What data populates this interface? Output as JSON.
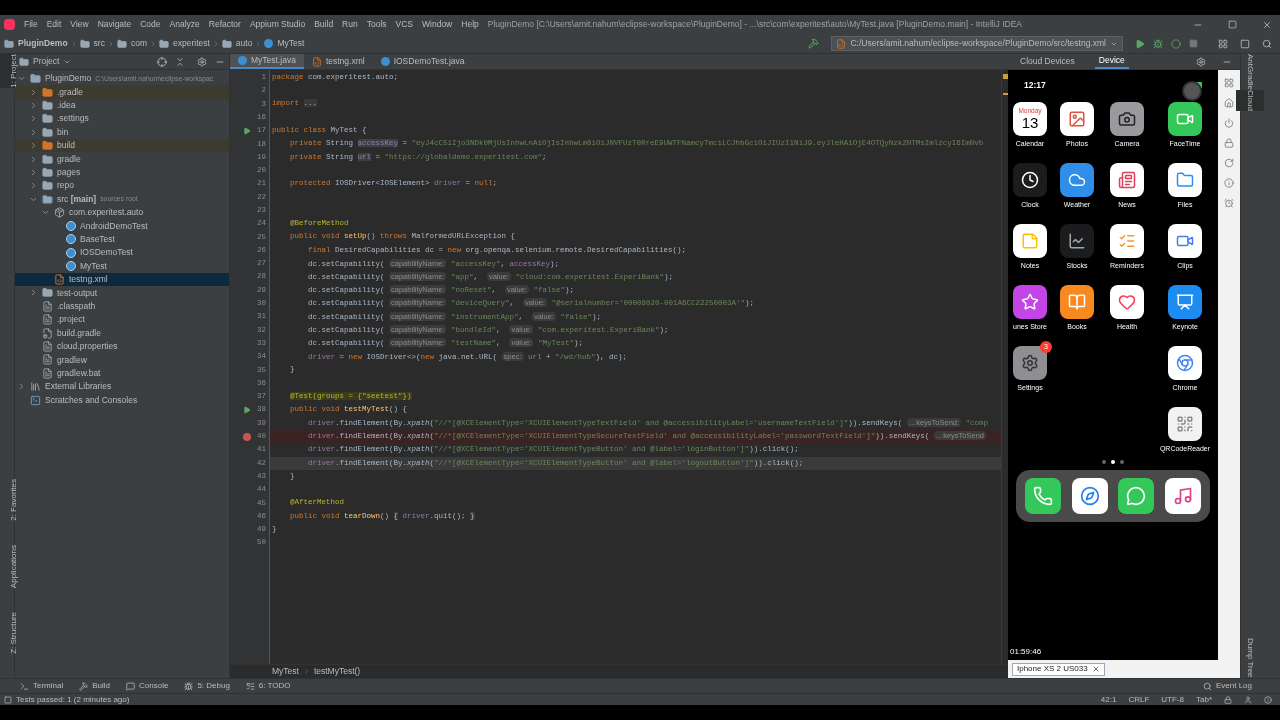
{
  "menu_bar": {
    "items": [
      "File",
      "Edit",
      "View",
      "Navigate",
      "Code",
      "Analyze",
      "Refactor",
      "Appium Studio",
      "Build",
      "Run",
      "Tools",
      "VCS",
      "Window",
      "Help"
    ],
    "title": "PluginDemo [C:\\Users\\amit.nahum\\eclipse-workspace\\PluginDemo] - ...\\src\\com\\experitest\\auto\\MyTest.java [PluginDemo.main] - IntelliJ IDEA"
  },
  "nav_bar": {
    "breadcrumbs": [
      {
        "label": "PluginDemo",
        "kind": "module"
      },
      {
        "label": "src",
        "kind": "folder"
      },
      {
        "label": "com",
        "kind": "folder"
      },
      {
        "label": "experitest",
        "kind": "folder"
      },
      {
        "label": "auto",
        "kind": "folder"
      },
      {
        "label": "MyTest",
        "kind": "class"
      }
    ],
    "run_config": "C:/Users/amit.nahum/eclipse-workspace/PluginDemo/src/testng.xml"
  },
  "left_stripe": [
    {
      "label": "1: Project",
      "selected": true
    },
    {
      "label": "2: Favorites",
      "selected": false
    },
    {
      "label": "Applications",
      "selected": false
    },
    {
      "label": "Z: Structure",
      "selected": false
    }
  ],
  "project_panel": {
    "title": "Project",
    "tree": [
      {
        "label": "PluginDemo",
        "hint": "C:\\Users\\amit.nahum\\eclipse-workspac",
        "kind": "module",
        "expanded": true,
        "selected": false,
        "children": [
          {
            "label": ".gradle",
            "kind": "excluded",
            "expanded": false,
            "selected": false
          },
          {
            "label": ".idea",
            "kind": "folder",
            "expanded": false,
            "selected": false
          },
          {
            "label": ".settings",
            "kind": "folder",
            "expanded": false,
            "selected": false
          },
          {
            "label": "bin",
            "kind": "folder",
            "expanded": false,
            "selected": false
          },
          {
            "label": "build",
            "kind": "excluded",
            "expanded": false,
            "selected": false
          },
          {
            "label": "gradle",
            "kind": "folder",
            "expanded": false,
            "selected": false
          },
          {
            "label": "pages",
            "kind": "folder",
            "expanded": false,
            "selected": false
          },
          {
            "label": "repo",
            "kind": "folder",
            "expanded": false,
            "selected": false
          },
          {
            "label": "src **[main]**",
            "hint": "sources root",
            "kind": "source",
            "expanded": true,
            "selected": false,
            "children": [
              {
                "label": "com.experitest.auto",
                "kind": "package",
                "expanded": true,
                "selected": false,
                "children": [
                  {
                    "label": "AndroidDemoTest",
                    "kind": "class",
                    "selected": false
                  },
                  {
                    "label": "BaseTest",
                    "kind": "class",
                    "selected": false
                  },
                  {
                    "label": "IOSDemoTest",
                    "kind": "class",
                    "selected": false
                  },
                  {
                    "label": "MyTest",
                    "kind": "class",
                    "selected": false
                  }
                ]
              },
              {
                "label": "testng.xml",
                "kind": "xml",
                "selected": true
              }
            ]
          },
          {
            "label": "test-output",
            "kind": "folder",
            "expanded": false,
            "selected": false
          },
          {
            "label": ".classpath",
            "kind": "file",
            "selected": false
          },
          {
            "label": ".project",
            "kind": "file",
            "selected": false
          },
          {
            "label": "build.gradle",
            "kind": "gradle",
            "selected": false
          },
          {
            "label": "cloud.properties",
            "kind": "file",
            "selected": false
          },
          {
            "label": "gradlew",
            "kind": "file",
            "selected": false
          },
          {
            "label": "gradlew.bat",
            "kind": "file",
            "selected": false
          }
        ]
      },
      {
        "label": "External Libraries",
        "kind": "libraries",
        "expanded": false,
        "selected": false
      },
      {
        "label": "Scratches and Consoles",
        "kind": "scratches",
        "selected": false
      }
    ]
  },
  "editor": {
    "tabs": [
      {
        "label": "MyTest.java",
        "kind": "class",
        "selected": true
      },
      {
        "label": "testng.xml",
        "kind": "xml",
        "selected": false
      },
      {
        "label": "IOSDemoTest.java",
        "kind": "class",
        "selected": false
      }
    ],
    "lines": [
      {
        "num": "1",
        "runnable": false,
        "breakpoint": false,
        "current": false,
        "tokens": [
          {
            "kind": "kw",
            "text": "package"
          },
          {
            "kind": "plain",
            "text": " com.experitest.auto;"
          }
        ]
      },
      {
        "num": "2",
        "runnable": false,
        "breakpoint": false,
        "current": false
      },
      {
        "num": "3",
        "runnable": false,
        "breakpoint": false,
        "current": false,
        "tokens": [
          {
            "kind": "kw",
            "text": "import "
          },
          {
            "kind": "fold",
            "text": "..."
          }
        ]
      },
      {
        "num": "16",
        "runnable": false,
        "breakpoint": false,
        "current": false
      },
      {
        "num": "17",
        "runnable": true,
        "breakpoint": false,
        "current": false,
        "tokens": [
          {
            "kind": "kw",
            "text": "public class"
          },
          {
            "kind": "plain",
            "text": " MyTest {"
          }
        ]
      },
      {
        "num": "18",
        "runnable": false,
        "breakpoint": false,
        "current": false,
        "tokens": [
          {
            "kind": "kw",
            "text": "    private"
          },
          {
            "kind": "plain",
            "text": " String "
          },
          {
            "kind": "field_hl",
            "text": "accessKey"
          },
          {
            "kind": "plain",
            "text": " = "
          },
          {
            "kind": "str",
            "text": "\"eyJ4cC51Ijo3NDk0MjUsInhwLnAiOjIsInhwLm0iOiJNVFUzT0RreE9UWTFNamcyTmciLCJhbGciOiJIUzI1NiJ9.eyJleHAiOjE4OTQyNzk2NTMsImlzcyI6ImNvb"
          }
        ]
      },
      {
        "num": "19",
        "runnable": false,
        "breakpoint": false,
        "current": false,
        "tokens": [
          {
            "kind": "kw",
            "text": "    private"
          },
          {
            "kind": "plain",
            "text": " String "
          },
          {
            "kind": "field_hl",
            "text": "url"
          },
          {
            "kind": "plain",
            "text": " = "
          },
          {
            "kind": "str",
            "text": "\"https://globaldemo.experitest.com\""
          },
          {
            "kind": "plain",
            "text": ";"
          }
        ]
      },
      {
        "num": "20",
        "runnable": false,
        "breakpoint": false,
        "current": false
      },
      {
        "num": "21",
        "runnable": false,
        "breakpoint": false,
        "current": false,
        "tokens": [
          {
            "kind": "kw",
            "text": "    protected"
          },
          {
            "kind": "plain",
            "text": " IOSDriver<IOSElement> "
          },
          {
            "kind": "field",
            "text": "driver"
          },
          {
            "kind": "plain",
            "text": " = "
          },
          {
            "kind": "kw",
            "text": "null"
          },
          {
            "kind": "plain",
            "text": ";"
          }
        ]
      },
      {
        "num": "22",
        "runnable": false,
        "breakpoint": false,
        "current": false
      },
      {
        "num": "23",
        "runnable": false,
        "breakpoint": false,
        "current": false
      },
      {
        "num": "24",
        "runnable": false,
        "breakpoint": false,
        "current": false,
        "tokens": [
          {
            "kind": "ann",
            "text": "    @BeforeMethod"
          }
        ]
      },
      {
        "num": "25",
        "runnable": false,
        "breakpoint": false,
        "current": false,
        "tokens": [
          {
            "kind": "kw",
            "text": "    public void "
          },
          {
            "kind": "method",
            "text": "setUp"
          },
          {
            "kind": "plain",
            "text": "() "
          },
          {
            "kind": "kw",
            "text": "throws"
          },
          {
            "kind": "plain",
            "text": " MalformedURLException {"
          }
        ]
      },
      {
        "num": "26",
        "runnable": false,
        "breakpoint": false,
        "current": false,
        "tokens": [
          {
            "kind": "kw",
            "text": "        final"
          },
          {
            "kind": "plain",
            "text": " DesiredCapabilities dc = "
          },
          {
            "kind": "kw",
            "text": "new"
          },
          {
            "kind": "plain",
            "text": " org.openqa.selenium.remote.DesiredCapabilities();"
          }
        ]
      },
      {
        "num": "27",
        "runnable": false,
        "breakpoint": false,
        "current": false,
        "tokens": [
          {
            "kind": "plain",
            "text": "        dc.setCapability( "
          },
          {
            "kind": "hint",
            "text": "capabilityName:"
          },
          {
            "kind": "str",
            "text": " \"accessKey\""
          },
          {
            "kind": "plain",
            "text": ", "
          },
          {
            "kind": "field",
            "text": "accessKey"
          },
          {
            "kind": "plain",
            "text": ");"
          }
        ]
      },
      {
        "num": "28",
        "runnable": false,
        "breakpoint": false,
        "current": false,
        "tokens": [
          {
            "kind": "plain",
            "text": "        dc.setCapability( "
          },
          {
            "kind": "hint",
            "text": "capabilityName:"
          },
          {
            "kind": "str",
            "text": " \"app\""
          },
          {
            "kind": "plain",
            "text": ",  "
          },
          {
            "kind": "hint",
            "text": "value:"
          },
          {
            "kind": "str",
            "text": " \"cloud:com.experitest.ExperiBank\""
          },
          {
            "kind": "plain",
            "text": ");"
          }
        ]
      },
      {
        "num": "29",
        "runnable": false,
        "breakpoint": false,
        "current": false,
        "tokens": [
          {
            "kind": "plain",
            "text": "        dc.setCapability( "
          },
          {
            "kind": "hint",
            "text": "capabilityName:"
          },
          {
            "kind": "str",
            "text": " \"noReset\""
          },
          {
            "kind": "plain",
            "text": ",  "
          },
          {
            "kind": "hint",
            "text": "value:"
          },
          {
            "kind": "str",
            "text": " \"false\""
          },
          {
            "kind": "plain",
            "text": ");"
          }
        ]
      },
      {
        "num": "30",
        "runnable": false,
        "breakpoint": false,
        "current": false,
        "tokens": [
          {
            "kind": "plain",
            "text": "        dc.setCapability( "
          },
          {
            "kind": "hint",
            "text": "capabilityName:"
          },
          {
            "kind": "str",
            "text": " \"deviceQuery\""
          },
          {
            "kind": "plain",
            "text": ",  "
          },
          {
            "kind": "hint",
            "text": "value:"
          },
          {
            "kind": "str",
            "text": " \"@serialnumber='00008020-001A6CC22250003A'\""
          },
          {
            "kind": "plain",
            "text": ");"
          }
        ]
      },
      {
        "num": "31",
        "runnable": false,
        "breakpoint": false,
        "current": false,
        "tokens": [
          {
            "kind": "plain",
            "text": "        dc.setCapability( "
          },
          {
            "kind": "hint",
            "text": "capabilityName:"
          },
          {
            "kind": "str",
            "text": " \"instrumentApp\""
          },
          {
            "kind": "plain",
            "text": ",  "
          },
          {
            "kind": "hint",
            "text": "value:"
          },
          {
            "kind": "str",
            "text": " \"false\""
          },
          {
            "kind": "plain",
            "text": ");"
          }
        ]
      },
      {
        "num": "32",
        "runnable": false,
        "breakpoint": false,
        "current": false,
        "tokens": [
          {
            "kind": "plain",
            "text": "        dc.setCapability( "
          },
          {
            "kind": "hint",
            "text": "capabilityName:"
          },
          {
            "kind": "str",
            "text": " \"bundleId\""
          },
          {
            "kind": "plain",
            "text": ",  "
          },
          {
            "kind": "hint",
            "text": "value:"
          },
          {
            "kind": "str",
            "text": " \"com.experitest.ExperiBank\""
          },
          {
            "kind": "plain",
            "text": ");"
          }
        ]
      },
      {
        "num": "33",
        "runnable": false,
        "breakpoint": false,
        "current": false,
        "tokens": [
          {
            "kind": "plain",
            "text": "        dc.setCapability( "
          },
          {
            "kind": "hint",
            "text": "capabilityName:"
          },
          {
            "kind": "str",
            "text": " \"testName\""
          },
          {
            "kind": "plain",
            "text": ",  "
          },
          {
            "kind": "hint",
            "text": "value:"
          },
          {
            "kind": "str",
            "text": " \"MyTest\""
          },
          {
            "kind": "plain",
            "text": ");"
          }
        ]
      },
      {
        "num": "34",
        "runnable": false,
        "breakpoint": false,
        "current": false,
        "tokens": [
          {
            "kind": "field",
            "text": "        driver"
          },
          {
            "kind": "plain",
            "text": " = "
          },
          {
            "kind": "kw",
            "text": "new"
          },
          {
            "kind": "plain",
            "text": " IOSDriver<>("
          },
          {
            "kind": "kw",
            "text": "new"
          },
          {
            "kind": "plain",
            "text": " java.net.URL( "
          },
          {
            "kind": "hint",
            "text": "spec:"
          },
          {
            "kind": "field",
            "text": " url"
          },
          {
            "kind": "plain",
            "text": " + "
          },
          {
            "kind": "str",
            "text": "\"/wd/hub\""
          },
          {
            "kind": "plain",
            "text": "), dc);"
          }
        ]
      },
      {
        "num": "35",
        "runnable": false,
        "breakpoint": false,
        "current": false,
        "tokens": [
          {
            "kind": "plain",
            "text": "    }"
          }
        ]
      },
      {
        "num": "36",
        "runnable": false,
        "breakpoint": false,
        "current": false
      },
      {
        "num": "37",
        "runnable": false,
        "breakpoint": false,
        "current": false,
        "tokens": [
          {
            "kind": "ann_hl",
            "text": "    @Test(groups = {\"seetest\"})"
          }
        ]
      },
      {
        "num": "38",
        "runnable": true,
        "breakpoint": false,
        "current": false,
        "tokens": [
          {
            "kind": "kw",
            "text": "    public void "
          },
          {
            "kind": "method",
            "text": "testMyTest"
          },
          {
            "kind": "plain",
            "text": "() {"
          }
        ]
      },
      {
        "num": "39",
        "runnable": false,
        "breakpoint": false,
        "current": false,
        "tokens": [
          {
            "kind": "field",
            "text": "        driver"
          },
          {
            "kind": "plain",
            "text": ".findElement(By."
          },
          {
            "kind": "italic",
            "text": "xpath"
          },
          {
            "kind": "plain",
            "text": "("
          },
          {
            "kind": "str",
            "text": "\"//*[@XCElementType='XCUIElementTypeTextField' and @accessibilityLabel='usernameTextField']\""
          },
          {
            "kind": "plain",
            "text": ")).sendKeys( "
          },
          {
            "kind": "hint",
            "text": "…keysToSend:"
          },
          {
            "kind": "str",
            "text": " \"comp"
          }
        ]
      },
      {
        "num": "40",
        "runnable": false,
        "breakpoint": true,
        "current": false,
        "tokens": [
          {
            "kind": "field",
            "text": "        driver"
          },
          {
            "kind": "plain",
            "text": ".findElement(By."
          },
          {
            "kind": "italic",
            "text": "xpath"
          },
          {
            "kind": "plain",
            "text": "("
          },
          {
            "kind": "str",
            "text": "\"//*[@XCElementType='XCUIElementTypeSecureTextField' and @accessibilityLabel='passwordTextField']\""
          },
          {
            "kind": "plain",
            "text": ")).sendKeys( "
          },
          {
            "kind": "hint",
            "text": "…keysToSend"
          }
        ]
      },
      {
        "num": "41",
        "runnable": false,
        "breakpoint": false,
        "current": false,
        "tokens": [
          {
            "kind": "field",
            "text": "        driver"
          },
          {
            "kind": "plain",
            "text": ".findElement(By."
          },
          {
            "kind": "italic",
            "text": "xpath"
          },
          {
            "kind": "plain",
            "text": "("
          },
          {
            "kind": "str",
            "text": "\"//*[@XCElementType='XCUIElementTypeButton' and @label='loginButton']\""
          },
          {
            "kind": "plain",
            "text": ")).click();"
          }
        ]
      },
      {
        "num": "42",
        "runnable": false,
        "breakpoint": false,
        "current": true,
        "tokens": [
          {
            "kind": "field",
            "text": "        driver"
          },
          {
            "kind": "plain",
            "text": ".findElement(By."
          },
          {
            "kind": "italic",
            "text": "xpath"
          },
          {
            "kind": "plain",
            "text": "("
          },
          {
            "kind": "str",
            "text": "\"//*[@XCElementType='XCUIElementTypeButton' and @label='logoutButton']\""
          },
          {
            "kind": "plain",
            "text": ")).click();"
          }
        ]
      },
      {
        "num": "43",
        "runnable": false,
        "breakpoint": false,
        "current": false,
        "tokens": [
          {
            "kind": "plain",
            "text": "    }"
          }
        ]
      },
      {
        "num": "44",
        "runnable": false,
        "breakpoint": false,
        "current": false
      },
      {
        "num": "45",
        "runnable": false,
        "breakpoint": false,
        "current": false,
        "tokens": [
          {
            "kind": "ann",
            "text": "    @AfterMethod"
          }
        ]
      },
      {
        "num": "46",
        "runnable": false,
        "breakpoint": false,
        "current": false,
        "tokens": [
          {
            "kind": "kw",
            "text": "    public void "
          },
          {
            "kind": "method",
            "text": "tearDown"
          },
          {
            "kind": "plain",
            "text": "() "
          },
          {
            "kind": "fold",
            "text": "{"
          },
          {
            "kind": "field",
            "text": " driver"
          },
          {
            "kind": "plain",
            "text": ".quit(); "
          },
          {
            "kind": "fold",
            "text": "}"
          }
        ]
      },
      {
        "num": "49",
        "runnable": false,
        "breakpoint": false,
        "current": false,
        "tokens": [
          {
            "kind": "plain",
            "text": "}"
          }
        ]
      },
      {
        "num": "50",
        "runnable": false,
        "breakpoint": false,
        "current": false
      }
    ],
    "breadcrumb": [
      "MyTest",
      "testMyTest()"
    ]
  },
  "device_panel": {
    "tabs": [
      {
        "label": "Cloud Devices",
        "selected": false
      },
      {
        "label": "Device",
        "selected": true
      }
    ],
    "clock": "12:17",
    "home_rows": [
      [
        {
          "name": "Calendar",
          "color": "#ffffff",
          "day": "Monday",
          "date": "13"
        },
        {
          "name": "Photos",
          "color": "#ffffff"
        },
        {
          "name": "Camera",
          "color": "#9a9a9e"
        },
        {
          "name": "FaceTime",
          "color": "#34c759"
        }
      ],
      [
        {
          "name": "Clock",
          "color": "#1c1c1e"
        },
        {
          "name": "Weather",
          "color": "#2f8ee8"
        },
        {
          "name": "News",
          "color": "#ffffff"
        },
        {
          "name": "Files",
          "color": "#ffffff"
        }
      ],
      [
        {
          "name": "Notes",
          "color": "#ffffff"
        },
        {
          "name": "Stocks",
          "color": "#1c1c1e"
        },
        {
          "name": "Reminders",
          "color": "#ffffff"
        },
        {
          "name": "Clips",
          "color": "#ffffff"
        }
      ],
      [
        {
          "name": "unes Store",
          "color": "#c445e6"
        },
        {
          "name": "Books",
          "color": "#f7891e"
        },
        {
          "name": "Health",
          "color": "#ffffff"
        },
        {
          "name": "Keynote",
          "color": "#1c8cf0"
        }
      ],
      [
        {
          "name": "Settings",
          "color": "#8e8e93",
          "badge": "3"
        },
        null,
        null,
        {
          "name": "Chrome",
          "color": "#ffffff"
        }
      ],
      [
        null,
        null,
        null,
        {
          "name": "QRCodeReader",
          "color": "#f2f2f2"
        }
      ]
    ],
    "page_dots": [
      {
        "selected": false
      },
      {
        "selected": true
      },
      {
        "selected": false
      }
    ],
    "dock": [
      {
        "color": "#34c759"
      },
      {
        "color": "#ffffff"
      },
      {
        "color": "#34c759"
      },
      {
        "color": "#ffffff"
      }
    ],
    "timer": "01:59:46",
    "device_tab": "Iphone XS 2 US033"
  },
  "right_stripe": [
    {
      "label": "Ant",
      "selected": false
    },
    {
      "label": "Gradle",
      "selected": false
    },
    {
      "label": "Cloud",
      "selected": true
    },
    {
      "label": "Dump Tree",
      "selected": false
    }
  ],
  "tool_windows": {
    "left": [
      {
        "label": "Terminal",
        "kind": "terminal"
      },
      {
        "label": "Build",
        "kind": "build"
      },
      {
        "label": "Console",
        "kind": "console"
      },
      {
        "label": "5: Debug",
        "kind": "debug"
      },
      {
        "label": "6: TODO",
        "kind": "todo"
      }
    ],
    "right": "Event Log"
  },
  "status_bar": {
    "message": "Tests passed: 1 (2 minutes ago)",
    "items": [
      "42:1",
      "CRLF",
      "UTF-8",
      "Tab*"
    ]
  }
}
